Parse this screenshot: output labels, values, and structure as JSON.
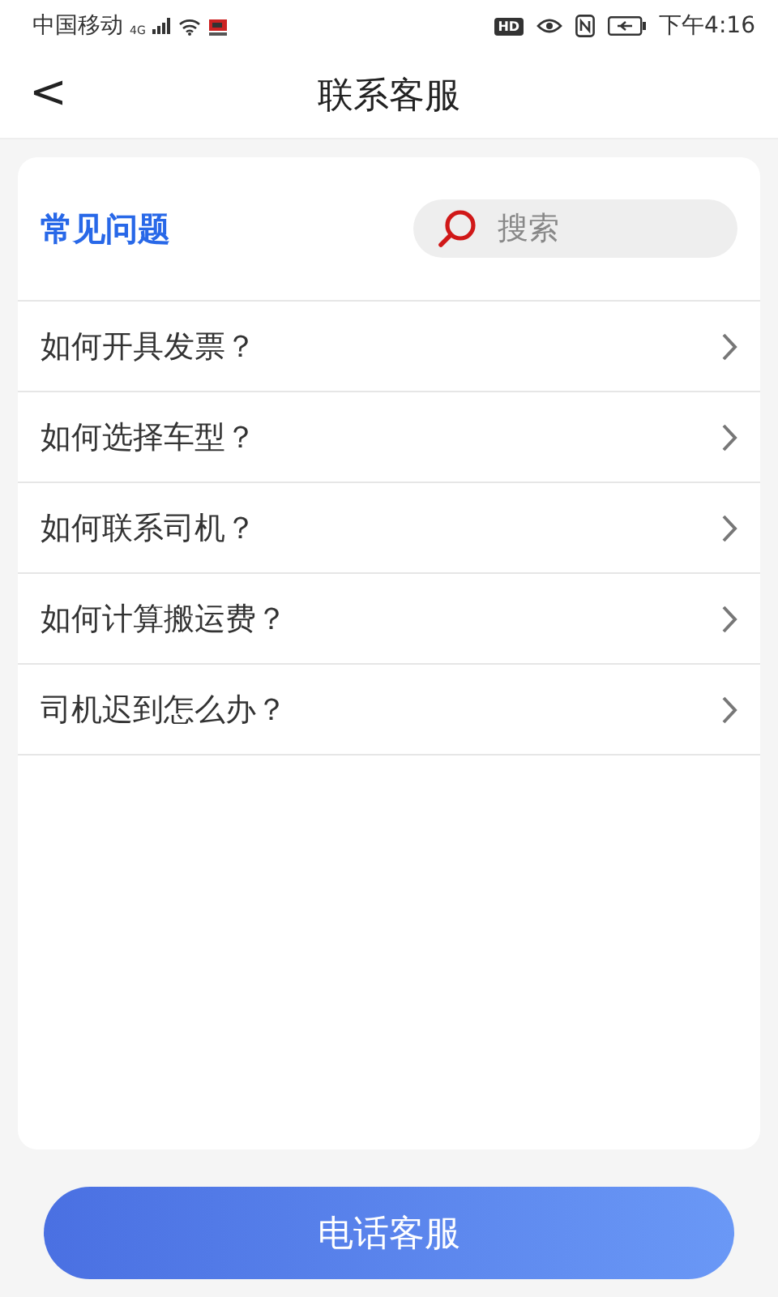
{
  "status_bar": {
    "carrier": "中国移动",
    "network": "4G",
    "hd": "HD",
    "time": "下午4:16"
  },
  "header": {
    "back": "<",
    "title": "联系客服"
  },
  "faq": {
    "title": "常见问题",
    "search": {
      "placeholder": "搜索"
    },
    "items": [
      {
        "label": "如何开具发票？"
      },
      {
        "label": "如何选择车型？"
      },
      {
        "label": "如何联系司机？"
      },
      {
        "label": "如何计算搬运费？"
      },
      {
        "label": "司机迟到怎么办？"
      }
    ]
  },
  "call_button": "电话客服"
}
